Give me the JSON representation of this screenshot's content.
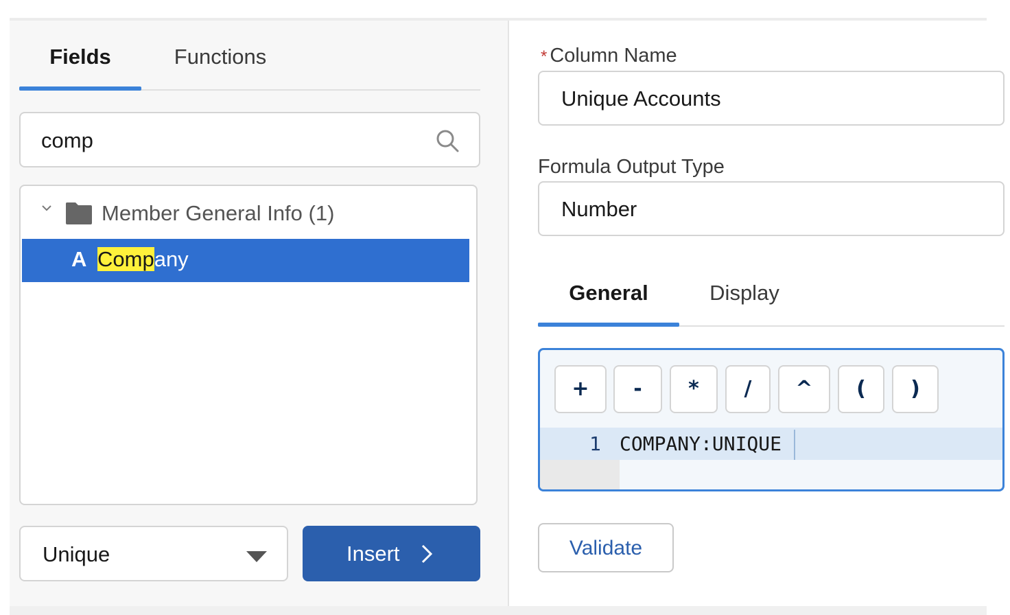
{
  "left_tabs": [
    {
      "label": "Fields",
      "active": true
    },
    {
      "label": "Functions",
      "active": false
    }
  ],
  "search": {
    "value": "comp",
    "icon": "search-icon"
  },
  "tree": {
    "group": {
      "label": "Member General Info (1)",
      "expanded": true,
      "icon": "folder-icon"
    },
    "items": [
      {
        "type_letter": "A",
        "match": "Comp",
        "rest": "any",
        "selected": true
      }
    ]
  },
  "aggregate_select": {
    "value": "Unique"
  },
  "insert_button": {
    "label": "Insert"
  },
  "column_name": {
    "label": "Column Name",
    "required_marker": "*",
    "value": "Unique Accounts"
  },
  "output_type": {
    "label": "Formula Output Type",
    "value": "Number"
  },
  "right_tabs": [
    {
      "label": "General",
      "active": true
    },
    {
      "label": "Display",
      "active": false
    }
  ],
  "operators": [
    "+",
    "-",
    "*",
    "/",
    "^",
    "(",
    ")"
  ],
  "editor": {
    "line_number": "1",
    "code": "COMPANY:UNIQUE"
  },
  "validate_button": {
    "label": "Validate"
  },
  "colors": {
    "accent": "#3b82d9",
    "selected_row": "#2f6fd0",
    "primary_button": "#2b5fad",
    "highlight": "#fff13b",
    "required": "#c23934"
  }
}
